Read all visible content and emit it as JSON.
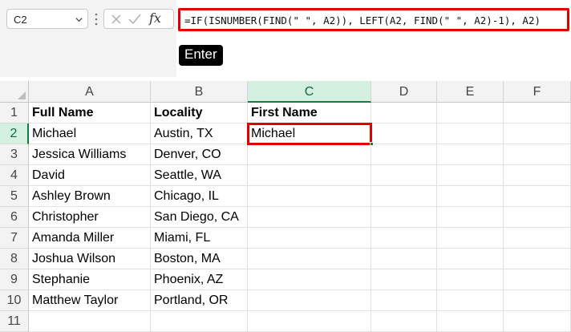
{
  "namebox": {
    "value": "C2"
  },
  "formula_bar": {
    "fx_label": "fx",
    "formula": "=IF(ISNUMBER(FIND(\" \", A2)), LEFT(A2, FIND(\" \", A2)-1), A2)"
  },
  "key_hint": "Enter",
  "columns": [
    "A",
    "B",
    "C",
    "D",
    "E",
    "F"
  ],
  "rows": [
    "1",
    "2",
    "3",
    "4",
    "5",
    "6",
    "7",
    "8",
    "9",
    "10",
    "11"
  ],
  "cells": {
    "A1": "Full Name",
    "B1": "Locality",
    "C1": "First Name",
    "A2": "Michael",
    "B2": "Austin, TX",
    "C2": "Michael",
    "A3": "Jessica Williams",
    "B3": "Denver, CO",
    "A4": "David",
    "B4": "Seattle, WA",
    "A5": "Ashley Brown",
    "B5": "Chicago, IL",
    "A6": "Christopher",
    "B6": "San Diego, CA",
    "A7": "Amanda Miller",
    "B7": "Miami, FL",
    "A8": "Joshua Wilson",
    "B8": "Boston, MA",
    "A9": "Stephanie",
    "B9": "Phoenix, AZ",
    "A10": "Matthew Taylor",
    "B10": "Portland, OR"
  },
  "active_cell": "C2",
  "accent_colors": {
    "highlight_red": "#e00000",
    "excel_green": "#107c41"
  }
}
